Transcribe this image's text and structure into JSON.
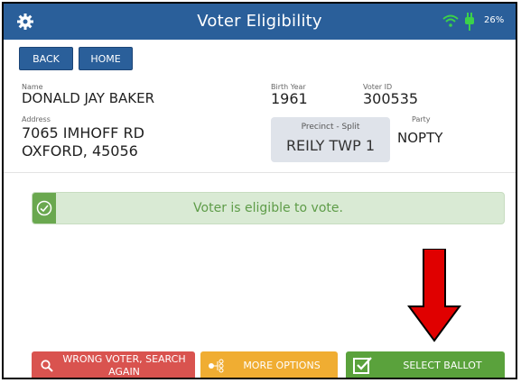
{
  "header": {
    "title": "Voter Eligibility",
    "battery": "26%",
    "icons": {
      "settings": "gear-icon",
      "wifi": "wifi-icon",
      "power": "plug-icon"
    }
  },
  "nav": {
    "back": "BACK",
    "home": "HOME"
  },
  "voter": {
    "name_label": "Name",
    "name": "DONALD JAY BAKER",
    "address_label": "Address",
    "address_line1": "7065 IMHOFF RD",
    "address_line2": "OXFORD, 45056",
    "birth_year_label": "Birth Year",
    "birth_year": "1961",
    "voter_id_label": "Voter ID",
    "voter_id": "300535",
    "precinct_label": "Precinct - Split",
    "precinct": "REILY TWP 1",
    "party_label": "Party",
    "party": "NOPTY"
  },
  "status": {
    "message": "Voter is eligible to vote."
  },
  "actions": {
    "wrong_voter": "WRONG VOTER, SEARCH AGAIN",
    "more_options": "MORE OPTIONS",
    "select_ballot": "SELECT BALLOT"
  },
  "colors": {
    "header": "#2a5f9a",
    "banner_bg": "#d9ead4",
    "banner_text": "#5e9c48",
    "wrong_voter": "#d9534f",
    "more_options": "#f0ad32",
    "select_ballot": "#5aa23c",
    "annotation_arrow": "#e00000"
  }
}
